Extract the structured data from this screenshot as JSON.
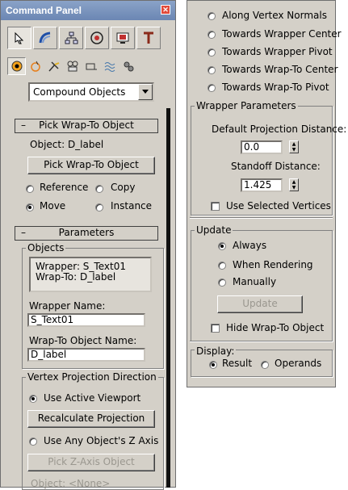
{
  "left_panel": {
    "title": "Command Panel",
    "tabs": [
      "create-icon",
      "modify-icon",
      "hierarchy-icon",
      "motion-icon",
      "display-icon",
      "utilities-icon"
    ],
    "category_icons": [
      "geometry-icon",
      "shapes-icon",
      "lights-icon",
      "cameras-icon",
      "helpers-icon",
      "spacewarps-icon",
      "systems-icon"
    ],
    "category_dropdown": "Compound Objects",
    "pick_rollout": {
      "title": "Pick Wrap-To Object",
      "object_label": "Object: D_label",
      "pick_button": "Pick Wrap-To Object",
      "reference": "Reference",
      "copy": "Copy",
      "move": "Move",
      "instance": "Instance"
    },
    "parameters_rollout": {
      "title": "Parameters",
      "objects_group": "Objects",
      "objects_list": [
        "Wrapper: S_Text01",
        "Wrap-To: D_label"
      ],
      "wrapper_name_label": "Wrapper Name:",
      "wrapper_name_value": "S_Text01",
      "wrapto_name_label": "Wrap-To Object Name:",
      "wrapto_name_value": "D_label",
      "vertex_group": "Vertex Projection Direction",
      "use_active_viewport": "Use Active Viewport",
      "recalculate": "Recalculate Projection",
      "use_any_z": "Use Any Object's Z Axis",
      "pick_z": "Pick Z-Axis Object",
      "object_none": "Object: <None>"
    }
  },
  "right_panel": {
    "projection_options": [
      "Along Vertex Normals",
      "Towards Wrapper Center",
      "Towards Wrapper Pivot",
      "Towards Wrap-To Center",
      "Towards Wrap-To Pivot"
    ],
    "wrapper_params": {
      "title": "Wrapper Parameters",
      "default_distance_label": "Default Projection Distance:",
      "default_distance_value": "0.0",
      "standoff_label": "Standoff Distance:",
      "standoff_value": "1.425",
      "use_selected": "Use Selected Vertices"
    },
    "update": {
      "title": "Update",
      "always": "Always",
      "when_rendering": "When Rendering",
      "manually": "Manually",
      "update_button": "Update",
      "hide_wrapto": "Hide Wrap-To Object"
    },
    "display": {
      "title": "Display:",
      "result": "Result",
      "operands": "Operands"
    }
  }
}
